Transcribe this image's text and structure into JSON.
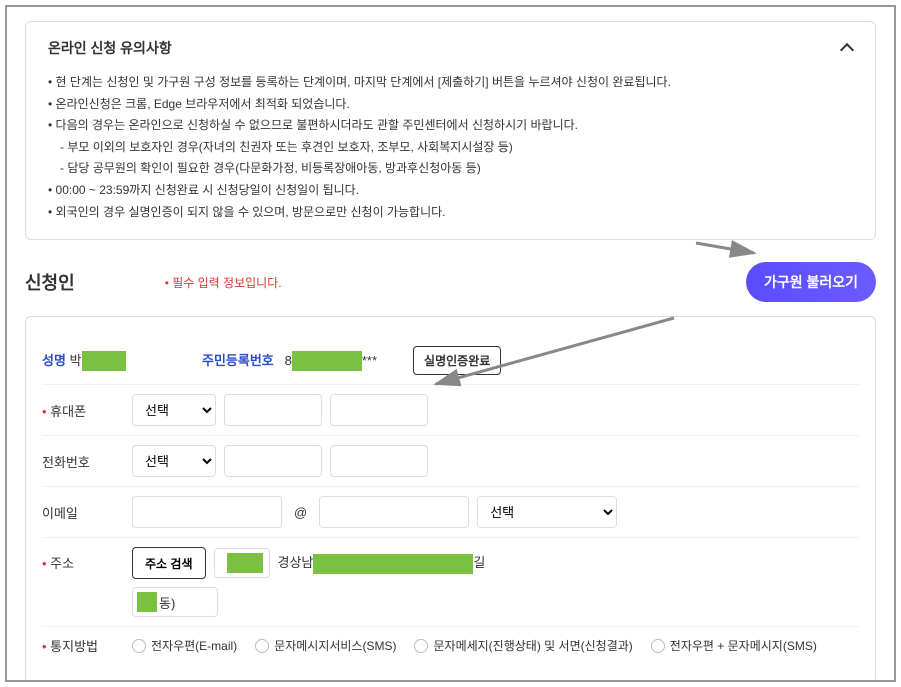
{
  "guide": {
    "title": "온라인 신청 유의사항",
    "notes": [
      "현 단계는 신청인 및 가구원 구성 정보를 등록하는 단계이며, 마지막 단계에서 [제출하기] 버튼을 누르셔야 신청이 완료됩니다.",
      "온라인신청은 크롬, Edge 브라우저에서 최적화 되었습니다.",
      "다음의 경우는 온라인으로 신청하실 수 없으므로 불편하시더라도 관할 주민센터에서 신청하시기 바랍니다."
    ],
    "sub_notes": [
      "- 부모 이외의 보호자인 경우(자녀의 친권자 또는 후견인 보호자, 조부모, 사회복지시설장 등)",
      "- 담당 공무원의 확인이 필요한 경우(다문화가정, 비등록장애아동, 방과후신청아동 등)"
    ],
    "notes2": [
      "00:00 ~ 23:59까지 신청완료 시 신청당일이 신청일이 됩니다.",
      "외국인의 경우 실명인증이 되지 않을 수 있으며, 방문으로만 신청이 가능합니다."
    ]
  },
  "applicant": {
    "section_title": "신청인",
    "required_note": "• 필수 입력 정보입니다.",
    "load_members_btn": "가구원 불러오기",
    "labels": {
      "name": "성명",
      "ssn": "주민등록번호",
      "cert_done": "실명인증완료",
      "mobile": "휴대폰",
      "tel": "전화번호",
      "email": "이메일",
      "addr": "주소",
      "notice": "통지방법",
      "select": "선택",
      "addr_search": "주소 검색",
      "name_prefix": "박",
      "ssn_prefix": "8",
      "ssn_mask": "***",
      "addr_prefix": "경상남",
      "addr_suffix": "길",
      "addr_detail_suffix": "동)",
      "at": "@"
    },
    "notice_options": [
      "전자우편(E-mail)",
      "문자메시지서비스(SMS)",
      "문자메세지(진행상태) 및 서면(신청결과)",
      "전자우편 + 문자메시지(SMS)"
    ]
  }
}
